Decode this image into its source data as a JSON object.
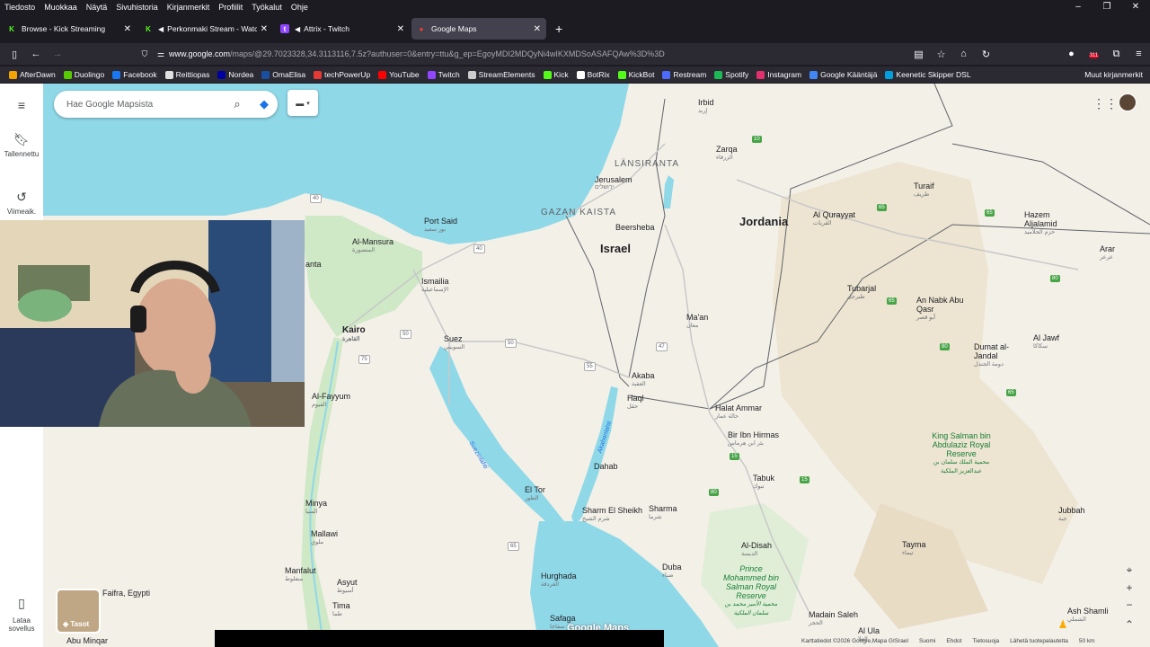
{
  "menubar": {
    "items": [
      "Tiedosto",
      "Muokkaa",
      "Näytä",
      "Sivuhistoria",
      "Kirjanmerkit",
      "Profiilit",
      "Työkalut",
      "Ohje"
    ]
  },
  "tabs": [
    {
      "label": "Browse - Kick Streaming",
      "color": "#53fc18"
    },
    {
      "label": "Perkonmaki Stream - Watch",
      "color": "#53fc18"
    },
    {
      "label": "Attrix - Twitch",
      "color": "#9146ff"
    },
    {
      "label": "Google Maps",
      "color": "#34a853"
    }
  ],
  "address": {
    "host": "www.google.com",
    "rest": "/maps/@29.7023328,34.3113116,7.5z?authuser=0&entry=ttu&g_ep=EgoyMDI2MDQyNi4wIKXMDSoASAFQAw%3D%3D"
  },
  "badge_count": "311",
  "bookmarks": [
    {
      "label": "AfterDawn",
      "color": "#f4a300"
    },
    {
      "label": "Duolingo",
      "color": "#58cc02"
    },
    {
      "label": "Facebook",
      "color": "#1877f2"
    },
    {
      "label": "Reittiopas",
      "color": "#e0e0e0"
    },
    {
      "label": "Nordea",
      "color": "#0000a0"
    },
    {
      "label": "OmaElisa",
      "color": "#1a4fa0"
    },
    {
      "label": "techPowerUp",
      "color": "#e53935"
    },
    {
      "label": "YouTube",
      "color": "#ff0000"
    },
    {
      "label": "Twitch",
      "color": "#9146ff"
    },
    {
      "label": "StreamElements",
      "color": "#cccccc"
    },
    {
      "label": "Kick",
      "color": "#53fc18"
    },
    {
      "label": "BotRix",
      "color": "#ffffff"
    },
    {
      "label": "KickBot",
      "color": "#53fc18"
    },
    {
      "label": "Restream",
      "color": "#4d6bfe"
    },
    {
      "label": "Spotify",
      "color": "#1db954"
    },
    {
      "label": "Instagram",
      "color": "#e1306c"
    },
    {
      "label": "Google Kääntäjä",
      "color": "#4285f4"
    },
    {
      "label": "Keenetic Skipper DSL",
      "color": "#00a0e0"
    }
  ],
  "other_bookmarks": "Muut kirjanmerkit",
  "rail": {
    "saved": "Tallennettu",
    "recent": "Viimeaik.",
    "download": "Lataa sovellus"
  },
  "search": {
    "placeholder": "Hae Google Mapsista"
  },
  "layers_label": "Tasot",
  "map_labels": {
    "countries": [
      "Israel",
      "Jordania"
    ],
    "regions": [
      "LÄNSIRANTA",
      "GAZAN KAISTA"
    ],
    "cities": [
      {
        "name": "Irbid",
        "ar": "إربد"
      },
      {
        "name": "Zarqa",
        "ar": "الزرقاء"
      },
      {
        "name": "Jerusalem",
        "ar": "ירושלים"
      },
      {
        "name": "Beersheba",
        "ar": ""
      },
      {
        "name": "Port Said",
        "ar": "بور سعيد"
      },
      {
        "name": "Al-Mansura",
        "ar": "المنصورة"
      },
      {
        "name": "Ismailia",
        "ar": "الإسماعيلية"
      },
      {
        "name": "Kairo",
        "ar": "القاهرة"
      },
      {
        "name": "Suez",
        "ar": "السويس"
      },
      {
        "name": "Al-Fayyum",
        "ar": "الفيوم"
      },
      {
        "name": "Minya",
        "ar": "المنيا"
      },
      {
        "name": "Mallawi",
        "ar": "ملوي"
      },
      {
        "name": "Manfalut",
        "ar": "منفلوط"
      },
      {
        "name": "Asyut",
        "ar": "أسيوط"
      },
      {
        "name": "Tima",
        "ar": "طما"
      },
      {
        "name": "Akaba",
        "ar": "العقبة"
      },
      {
        "name": "Haql",
        "ar": "حقل"
      },
      {
        "name": "Ma'an",
        "ar": "معان"
      },
      {
        "name": "El Tor",
        "ar": "الطور"
      },
      {
        "name": "Dahab",
        "ar": ""
      },
      {
        "name": "Sharm El Sheikh",
        "ar": "شرم الشيخ"
      },
      {
        "name": "Sharma",
        "ar": "شرما"
      },
      {
        "name": "Hurghada",
        "ar": "الغردقة"
      },
      {
        "name": "Safaga",
        "ar": "سفاجا"
      },
      {
        "name": "Duba",
        "ar": "ضباء"
      },
      {
        "name": "Tabuk",
        "ar": "تبوك"
      },
      {
        "name": "Halat Ammar",
        "ar": "حالة عمار"
      },
      {
        "name": "Bir Ibn Hirmas",
        "ar": "بئر ابن هرماس"
      },
      {
        "name": "Al Qurayyat",
        "ar": "القريات"
      },
      {
        "name": "Tubarjal",
        "ar": "طبرجل"
      },
      {
        "name": "An Nabk Abu Qasr",
        "ar": "أبو قصر"
      },
      {
        "name": "Dumat al-Jandal",
        "ar": "دومة الجندل"
      },
      {
        "name": "Al Jawf",
        "ar": "سكاكا"
      },
      {
        "name": "Turaif",
        "ar": "طريف"
      },
      {
        "name": "Hazem Aljalamid",
        "ar": "حزم الجلاميد"
      },
      {
        "name": "Arar",
        "ar": "عرعر"
      },
      {
        "name": "Jubbah",
        "ar": "جبة"
      },
      {
        "name": "Tayma",
        "ar": "تيماء"
      },
      {
        "name": "Al-Disah",
        "ar": "الديسة"
      },
      {
        "name": "Madain Saleh",
        "ar": "الحجر"
      },
      {
        "name": "Al Ula",
        "ar": "العلا"
      },
      {
        "name": "Ash Shamli",
        "ar": "الشملي"
      },
      {
        "name": "Abu Minqar",
        "ar": ""
      },
      {
        "name": "Faifra, Egypti",
        "ar": ""
      },
      {
        "name": "anta",
        "ar": ""
      }
    ],
    "parks": [
      {
        "name": "King Salman bin Abdulaziz Royal Reserve",
        "ar": "محمية الملك سلمان بن عبدالعزيز الملكية"
      },
      {
        "name": "Prince Mohammed bin Salman Royal Reserve",
        "ar": "محمية الأمير محمد بن سلمان الملكية"
      }
    ],
    "water": [
      "Suezinlahti",
      "Akabanlahti"
    ],
    "route_numbers": [
      "10",
      "15",
      "40",
      "47",
      "50",
      "55",
      "65",
      "75",
      "80"
    ]
  },
  "watermark": "Google Maps",
  "footer": {
    "data": "Karttatiedot ©2026 Google,Mapa GISrael",
    "country": "Suomi",
    "terms": "Ehdot",
    "privacy": "Tietosuoja",
    "feedback": "Lähetä tuotepalautetta",
    "scale": "50 km"
  }
}
